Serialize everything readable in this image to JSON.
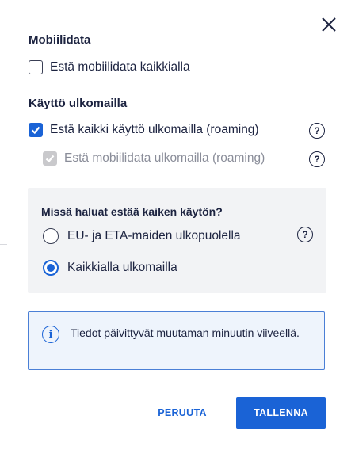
{
  "close_icon": "close-icon",
  "mobile_data": {
    "title": "Mobiilidata",
    "block_all": {
      "label": "Estä mobiilidata kaikkialla",
      "checked": false
    }
  },
  "abroad": {
    "title": "Käyttö ulkomailla",
    "block_roaming": {
      "label": "Estä kaikki käyttö ulkomailla (roaming)",
      "checked": true,
      "help": "?"
    },
    "block_data_roaming": {
      "label": "Estä mobiilidata ulkomailla (roaming)",
      "checked": true,
      "disabled": true,
      "help": "?"
    }
  },
  "where_panel": {
    "title": "Missä haluat estää kaiken käytön?",
    "options": [
      {
        "label": "EU- ja ETA-maiden ulkopuolella",
        "selected": false,
        "help": "?"
      },
      {
        "label": "Kaikkialla ulkomailla",
        "selected": true
      }
    ]
  },
  "info": {
    "icon": "info-icon",
    "glyph": "i",
    "text": "Tiedot päivittyvät muutaman minuutin viiveellä."
  },
  "buttons": {
    "cancel": "PERUUTA",
    "save": "TALLENNA"
  },
  "colors": {
    "accent": "#1a63d6",
    "text": "#1c2340",
    "info_bg": "#eef4fc",
    "panel_bg": "#f2f3f5"
  }
}
